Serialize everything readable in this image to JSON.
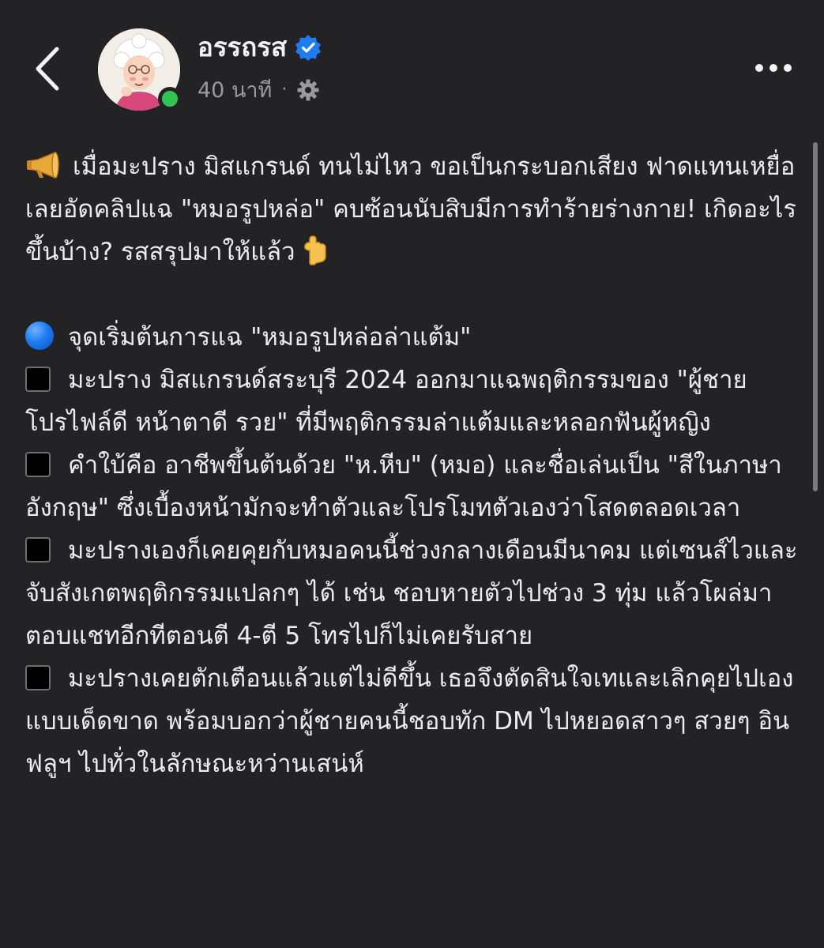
{
  "header": {
    "author_name": "อรรถรส",
    "time_label": "40 นาที",
    "separator": "·",
    "verified": true,
    "online": true,
    "icons": {
      "back": "chevron-left-icon",
      "verified": "verified-badge-icon",
      "privacy": "gear-icon",
      "more": "more-options-icon"
    }
  },
  "post": {
    "intro_icon": "megaphone-icon",
    "intro": "เมื่อมะปราง มิสแกรนด์ ทนไม่ไหว ขอเป็นกระบอกเสียง ฟาดแทนเหยื่อ เลยอัดคลิปแฉ \"หมอรูปหล่อ\" คบซ้อนนับสิบมีการทำร้ายร่างกาย! เกิดอะไรขึ้นบ้าง? รสสรุปมาให้แล้ว",
    "intro_end_icon": "point-down-icon",
    "section_icon": "blue-circle-icon",
    "section_title": "จุดเริ่มต้นการแฉ \"หมอรูปหล่อล่าแต้ม\"",
    "bullet_icon": "black-square-icon",
    "bullets": [
      "มะปราง มิสแกรนด์สระบุรี 2024 ออกมาแฉพฤติกรรมของ \"ผู้ชายโปรไฟล์ดี หน้าตาดี รวย\" ที่มีพฤติกรรมล่าแต้มและหลอกฟันผู้หญิง",
      "คำใบ้คือ อาชีพขึ้นต้นด้วย \"ห.หีบ\" (หมอ) และชื่อเล่นเป็น \"สีในภาษาอังกฤษ\" ซึ่งเบื้องหน้ามักจะทำตัวและโปรโมทตัวเองว่าโสดตลอดเวลา",
      "มะปรางเองก็เคยคุยกับหมอคนนี้ช่วงกลางเดือนมีนาคม แต่เซนส์ไวและจับสังเกตพฤติกรรมแปลกๆ ได้ เช่น ชอบหายตัวไปช่วง 3 ทุ่ม แล้วโผล่มาตอบแชทอีกทีตอนตี 4-ตี 5 โทรไปก็ไม่เคยรับสาย",
      "มะปรางเคยตักเตือนแล้วแต่ไม่ดีขึ้น เธอจึงตัดสินใจเทและเลิกคุยไปเองแบบเด็ดขาด พร้อมบอกว่าผู้ชายคนนี้ชอบทัก DM ไปหยอดสาวๆ สวยๆ อินฟลูฯ ไปทั่วในลักษณะหว่านเสน่ห์"
    ]
  },
  "colors": {
    "background": "#232325",
    "text": "#ececee",
    "muted": "#9a9a9e",
    "verified": "#1d7cf2",
    "online": "#31c452"
  }
}
